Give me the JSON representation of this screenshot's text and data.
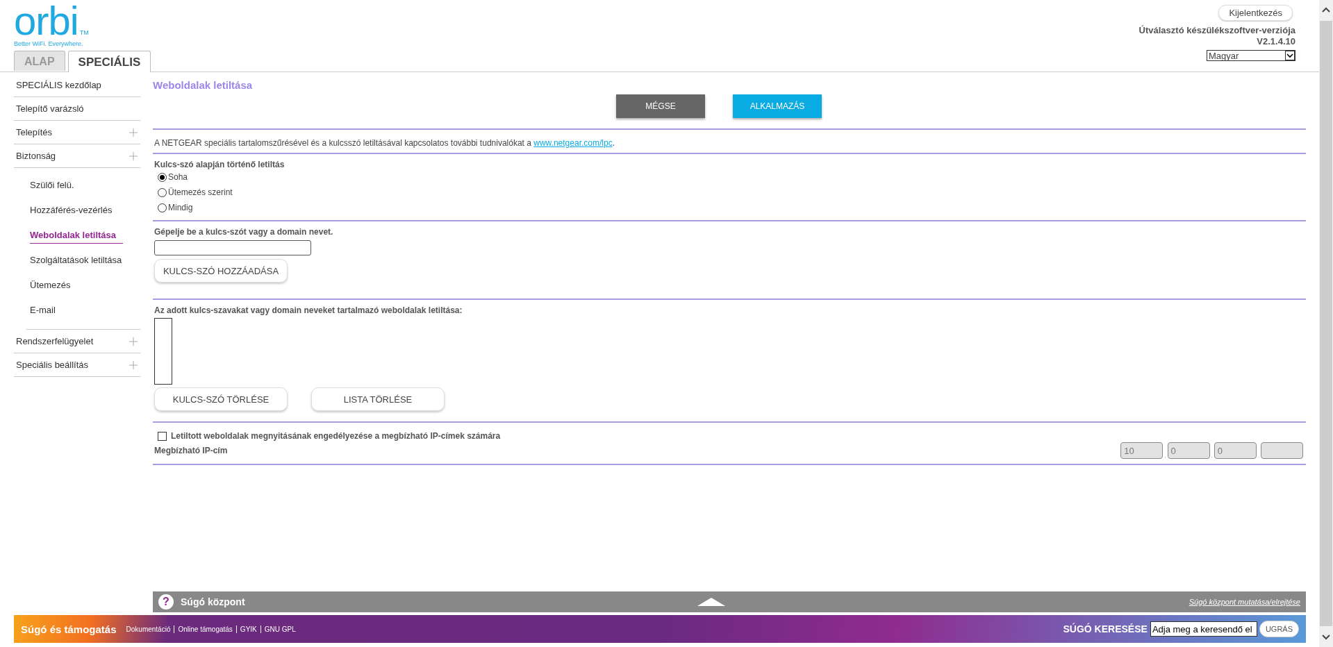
{
  "logo": {
    "name": "orbi",
    "tm": "TM",
    "tagline": "Better WiFi. Everywhere."
  },
  "tabs": [
    {
      "label": "ALAP",
      "selected": false
    },
    {
      "label": "SPECIÁLIS",
      "selected": true
    }
  ],
  "header": {
    "logout": "Kijelentkezés",
    "firmware_label": "Útválasztó készülékszoftver-verziója",
    "firmware_version": "V2.1.4.10",
    "language": "Magyar"
  },
  "sidebar": {
    "items": [
      {
        "label": "SPECIÁLIS kezdőlap",
        "kind": "link"
      },
      {
        "label": "Telepítő varázsló",
        "kind": "link"
      },
      {
        "label": "Telepítés",
        "kind": "group"
      },
      {
        "label": "Biztonság",
        "kind": "group",
        "children": [
          {
            "label": "Szülői felü.",
            "selected": false
          },
          {
            "label": "Hozzáférés-vezérlés",
            "selected": false
          },
          {
            "label": "Weboldalak letiltása",
            "selected": true
          },
          {
            "label": "Szolgáltatások letiltása",
            "selected": false
          },
          {
            "label": "Ütemezés",
            "selected": false
          },
          {
            "label": "E-mail",
            "selected": false
          }
        ]
      },
      {
        "label": "Rendszerfelügyelet",
        "kind": "group"
      },
      {
        "label": "Speciális beállítás",
        "kind": "group"
      }
    ]
  },
  "page": {
    "title": "Weboldalak letiltása",
    "buttons": [
      {
        "label": "MÉGSE",
        "kind": "cancel"
      },
      {
        "label": "ALKALMAZÁS",
        "kind": "apply"
      }
    ],
    "info": {
      "text": "A NETGEAR speciális tartalomszűrésével és a kulcsszó letiltásával kapcsolatos további tudnivalókat a ",
      "link": "www.netgear.com/lpc",
      "end": "."
    },
    "keyword_blocking": {
      "label": "Kulcs-szó alapján történő letiltás",
      "options": [
        {
          "label": "Soha",
          "selected": true
        },
        {
          "label": "Ütemezés szerint",
          "selected": false
        },
        {
          "label": "Mindig",
          "selected": false
        }
      ]
    },
    "keyword_entry": {
      "label": "Gépelje be a kulcs-szót vagy a domain nevet.",
      "add_button": "KULCS-SZÓ HOZZÁADÁSA"
    },
    "blocked_list": {
      "label": "Az adott kulcs-szavakat vagy domain neveket tartalmazó weboldalak letiltása:",
      "buttons": [
        "KULCS-SZÓ TÖRLÉSE",
        "LISTA TÖRLÉSE"
      ]
    },
    "trusted": {
      "checkbox_label": "Letiltott weboldalak megnyitásának engedélyezése a megbízható IP-címek számára",
      "checked": false,
      "ip_label": "Megbízható IP-cím",
      "ip_octets": [
        {
          "kind": "filled",
          "value": "10"
        },
        {
          "kind": "filled",
          "value": "0"
        },
        {
          "kind": "filled",
          "value": "0"
        },
        {
          "kind": "blank"
        }
      ],
      "separator": "."
    }
  },
  "help_bar": {
    "icon": "?",
    "title": "Súgó központ",
    "toggle_link": "Súgó központ mutatása/elrejtése"
  },
  "footer": {
    "title": "Súgó és támogatás",
    "links": [
      "Dokumentáció",
      "Online támogatás",
      "GYIK",
      "GNU GPL"
    ],
    "search_label": "SÚGÓ KERESÉSE",
    "search_placeholder": "Adja meg a keresendő el",
    "search_button": "UGRÁS"
  }
}
